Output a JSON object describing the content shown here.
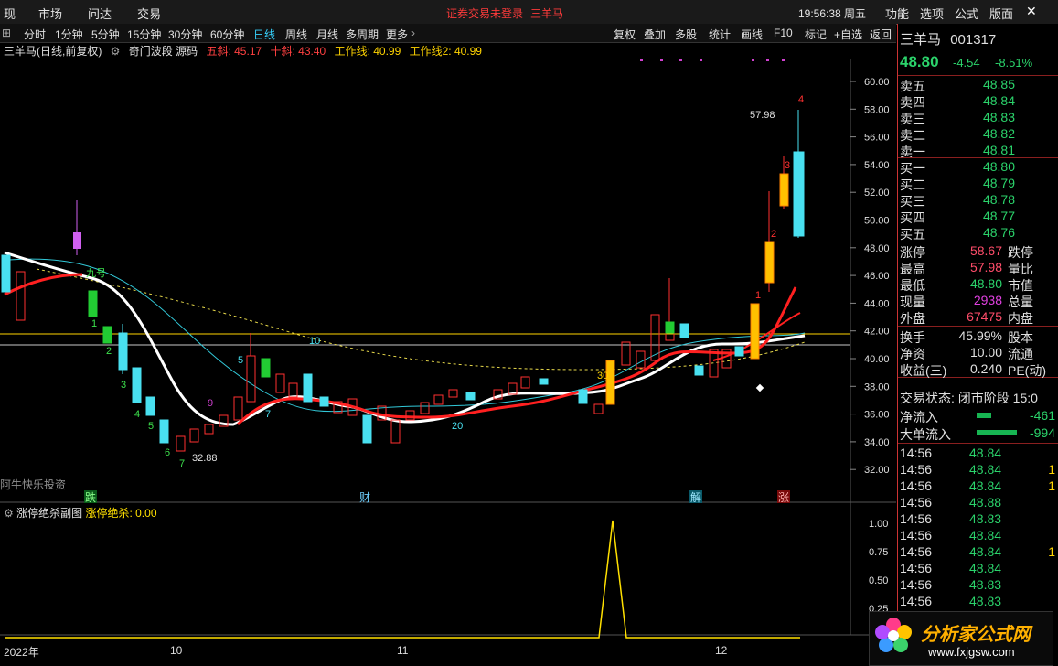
{
  "menu": {
    "items": [
      "现",
      "市场",
      "问达",
      "交易"
    ],
    "notice": "证券交易未登录",
    "stock_short": "三羊马",
    "clock": "19:56:38 周五",
    "right_items": [
      "功能",
      "选项",
      "公式",
      "版面"
    ]
  },
  "periods": {
    "items": [
      "分时",
      "1分钟",
      "5分钟",
      "15分钟",
      "30分钟",
      "60分钟",
      "日线",
      "周线",
      "月线",
      "多周期",
      "更多"
    ],
    "active": "日线"
  },
  "tools": [
    "复权",
    "叠加",
    "多股",
    "统计",
    "画线",
    "F10",
    "标记",
    "+自选",
    "返回"
  ],
  "legend": {
    "title": "三羊马(日线,前复权)",
    "indicator": "奇门波段 源码",
    "items": [
      {
        "label": "五斜: 45.17",
        "color": "#ff4040"
      },
      {
        "label": "十斜: 43.40",
        "color": "#ff4040"
      },
      {
        "label": "工作线: 40.99",
        "color": "#ffd400"
      },
      {
        "label": "工作线2: 40.99",
        "color": "#ffd400"
      }
    ]
  },
  "axis": {
    "price_ticks": [
      "60.00",
      "58.00",
      "56.00",
      "54.00",
      "52.00",
      "50.00",
      "48.00",
      "46.00",
      "44.00",
      "42.00",
      "40.00",
      "38.00",
      "36.00",
      "34.00",
      "32.00"
    ],
    "sub_ticks": [
      "1.00",
      "0.75",
      "0.50",
      "0.25"
    ],
    "date_labels": [
      "2022年",
      "10",
      "11",
      "12"
    ]
  },
  "annotations": {
    "high_label": "57.98",
    "low_label": "32.88",
    "nine_label": "九号",
    "watermark": "阿牛快乐投资",
    "markers": [
      "跌",
      "财",
      "解",
      "涨"
    ],
    "counts": [
      "1",
      "2",
      "3",
      "4",
      "5",
      "6",
      "7",
      "9",
      "5",
      "7",
      "10",
      "20",
      "30",
      "1",
      "2",
      "3",
      "4"
    ]
  },
  "sub": {
    "title": "涨停绝杀副图",
    "value_label": "涨停绝杀: 0.00"
  },
  "chart_data": {
    "type": "candlestick",
    "title": "三羊马(日线,前复权)",
    "ylim": [
      31,
      61
    ],
    "last_close": 48.8,
    "high": 57.98,
    "low": 32.88,
    "ma_values": {
      "五斜": 45.17,
      "十斜": 43.4,
      "工作线": 40.99,
      "工作线2": 40.99
    },
    "sub_series": {
      "name": "涨停绝杀",
      "ylim": [
        0,
        1
      ],
      "spike_value": 1.0
    }
  },
  "quote": {
    "name": "三羊马",
    "code": "001317",
    "price": "48.80",
    "change": "-4.54",
    "pct": "-8.51%",
    "asks": [
      {
        "label": "卖五",
        "price": "48.85"
      },
      {
        "label": "卖四",
        "price": "48.84"
      },
      {
        "label": "卖三",
        "price": "48.83"
      },
      {
        "label": "卖二",
        "price": "48.82"
      },
      {
        "label": "卖一",
        "price": "48.81"
      }
    ],
    "bids": [
      {
        "label": "买一",
        "price": "48.80"
      },
      {
        "label": "买二",
        "price": "48.79"
      },
      {
        "label": "买三",
        "price": "48.78"
      },
      {
        "label": "买四",
        "price": "48.77"
      },
      {
        "label": "买五",
        "price": "48.76"
      }
    ],
    "stats": [
      {
        "label": "涨停",
        "value": "58.67",
        "label2": "跌停",
        "color": "#ff4d6a"
      },
      {
        "label": "最高",
        "value": "57.98",
        "label2": "量比",
        "color": "#ff4d6a"
      },
      {
        "label": "最低",
        "value": "48.80",
        "label2": "市值",
        "color": "#2bd36b"
      },
      {
        "label": "现量",
        "value": "2938",
        "label2": "总量",
        "color": "#e040e0"
      },
      {
        "label": "外盘",
        "value": "67475",
        "label2": "内盘",
        "color": "#ff4d6a"
      }
    ],
    "stats2": [
      {
        "label": "换手",
        "value": "45.99%",
        "label2": "股本"
      },
      {
        "label": "净资",
        "value": "10.00",
        "label2": "流通"
      },
      {
        "label": "收益(三)",
        "value": "0.240",
        "label2": "PE(动)"
      }
    ],
    "status": "交易状态: 闭市阶段 15:0",
    "netflow": {
      "label": "净流入",
      "value": "-461"
    },
    "bigflow": {
      "label": "大单流入",
      "value": "-994"
    },
    "ticks": [
      {
        "time": "14:56",
        "price": "48.84",
        "vol": ""
      },
      {
        "time": "14:56",
        "price": "48.84",
        "vol": "1"
      },
      {
        "time": "14:56",
        "price": "48.84",
        "vol": "1"
      },
      {
        "time": "14:56",
        "price": "48.88",
        "vol": ""
      },
      {
        "time": "14:56",
        "price": "48.83",
        "vol": ""
      },
      {
        "time": "14:56",
        "price": "48.84",
        "vol": ""
      },
      {
        "time": "14:56",
        "price": "48.84",
        "vol": "1"
      },
      {
        "time": "14:56",
        "price": "48.84",
        "vol": ""
      },
      {
        "time": "14:56",
        "price": "48.83",
        "vol": ""
      },
      {
        "time": "14:56",
        "price": "48.83",
        "vol": ""
      }
    ]
  },
  "logo": {
    "text": "分析家公式网",
    "url": "www.fxjgsw.com"
  }
}
